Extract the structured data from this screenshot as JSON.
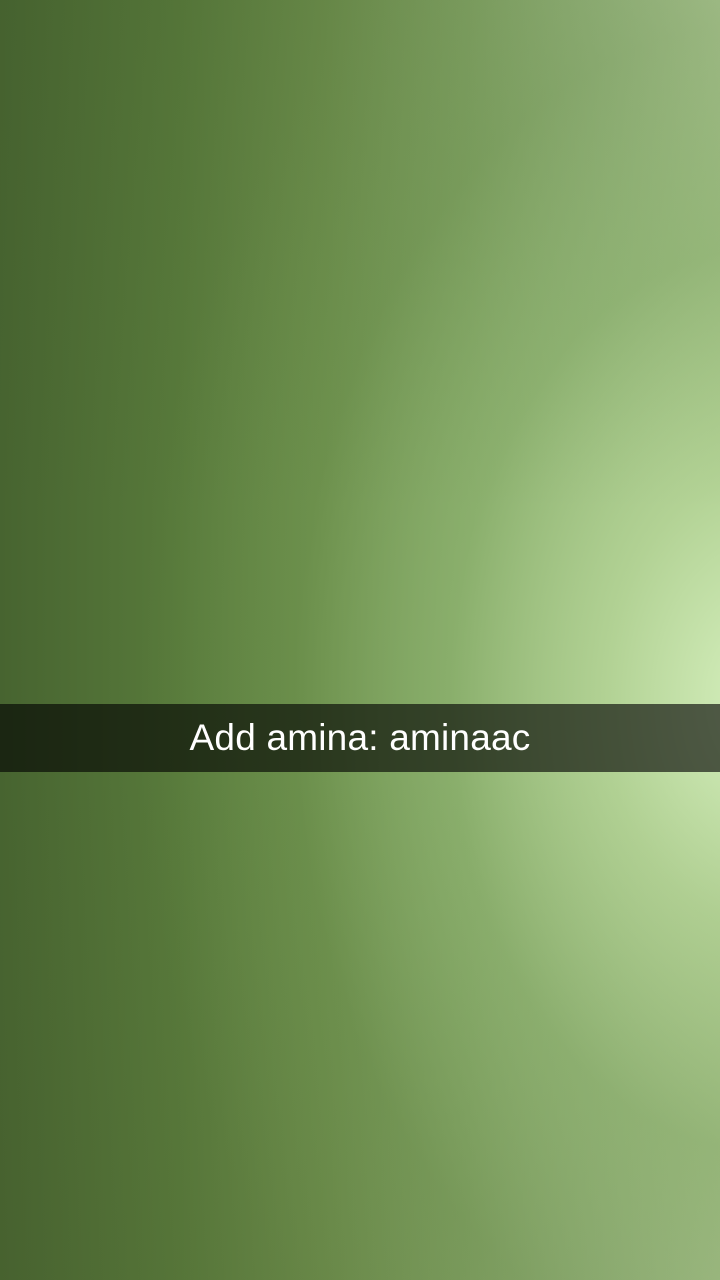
{
  "snap": {
    "caption": "Add amina: aminaac"
  },
  "colors": {
    "background_dark": "#476430",
    "background_light": "#d6f0be",
    "caption_bar": "rgba(0,0,0,0.62)",
    "caption_text": "#ffffff"
  }
}
